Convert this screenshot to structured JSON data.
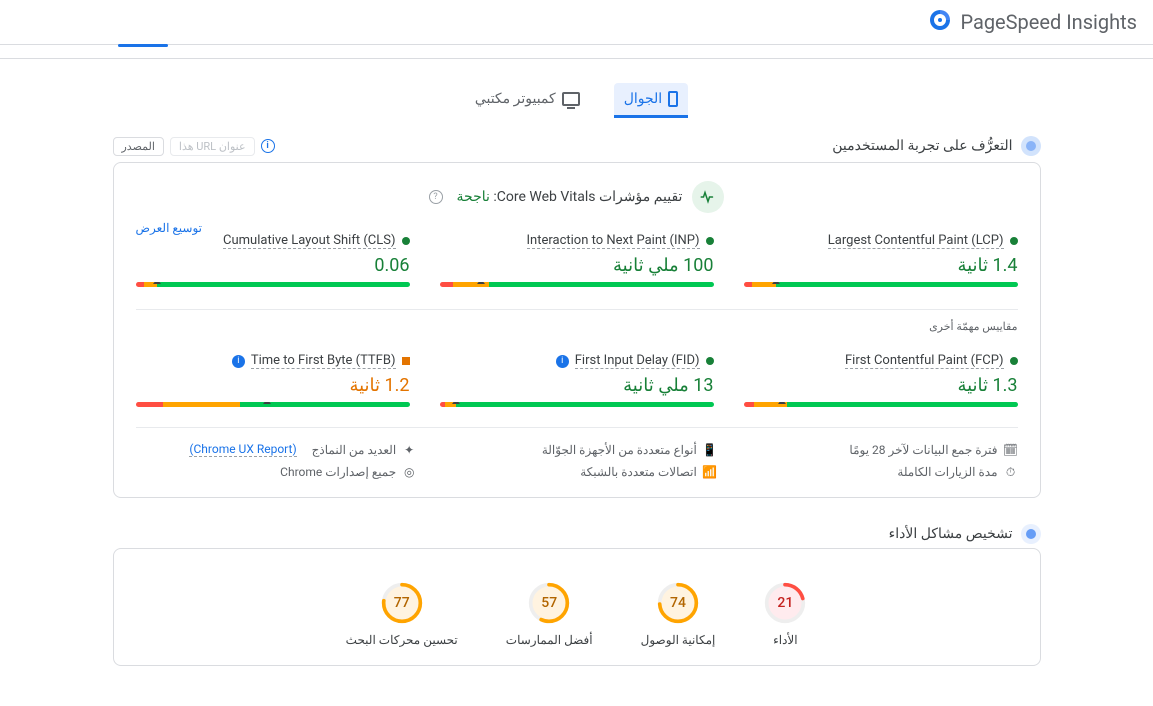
{
  "header": {
    "brand": "PageSpeed Insights"
  },
  "tabs": {
    "mobile": "الجوال",
    "desktop": "كمبيوتر مكتبي"
  },
  "toolbar": {
    "origin_chip": "المصدر",
    "url_chip": "عنوان URL هذا"
  },
  "ux_section": {
    "title": "التعرُّف على تجربة المستخدمين",
    "assessment_label": "تقييم مؤشرات Core Web Vitals:",
    "assessment_result": "ناجحة",
    "expand": "توسيع العرض",
    "other_metrics_label": "مقاييس مهمّة أخرى"
  },
  "metrics": {
    "lcp": {
      "name": "Largest Contentful Paint (LCP)",
      "value": "1.4 ثانية"
    },
    "inp": {
      "name": "Interaction to Next Paint (INP)",
      "value": "100 ملي ثانية"
    },
    "cls": {
      "name": "Cumulative Layout Shift (CLS)",
      "value": "0.06"
    },
    "fcp": {
      "name": "First Contentful Paint (FCP)",
      "value": "1.3 ثانية"
    },
    "fid": {
      "name": "First Input Delay (FID)",
      "value": "13 ملي ثانية"
    },
    "ttfb": {
      "name": "Time to First Byte (TTFB)",
      "value": "1.2 ثانية"
    }
  },
  "meta": {
    "period": "فترة جمع البيانات لآخر 28 يومًا",
    "devices": "أنواع متعددة من الأجهزة الجوّالة",
    "samples_prefix": "العديد من النماذج",
    "samples_link": "(Chrome UX Report)",
    "sessions": "مدة الزيارات الكاملة",
    "network": "اتصالات متعددة بالشبكة",
    "chrome": "جميع إصدارات Chrome"
  },
  "perf_section": {
    "title": "تشخيص مشاكل الأداء"
  },
  "gauges": {
    "performance": {
      "label": "الأداء",
      "score": "21"
    },
    "accessibility": {
      "label": "إمكانية الوصول",
      "score": "74"
    },
    "best": {
      "label": "أفضل الممارسات",
      "score": "57"
    },
    "seo": {
      "label": "تحسين محركات البحث",
      "score": "77"
    }
  }
}
